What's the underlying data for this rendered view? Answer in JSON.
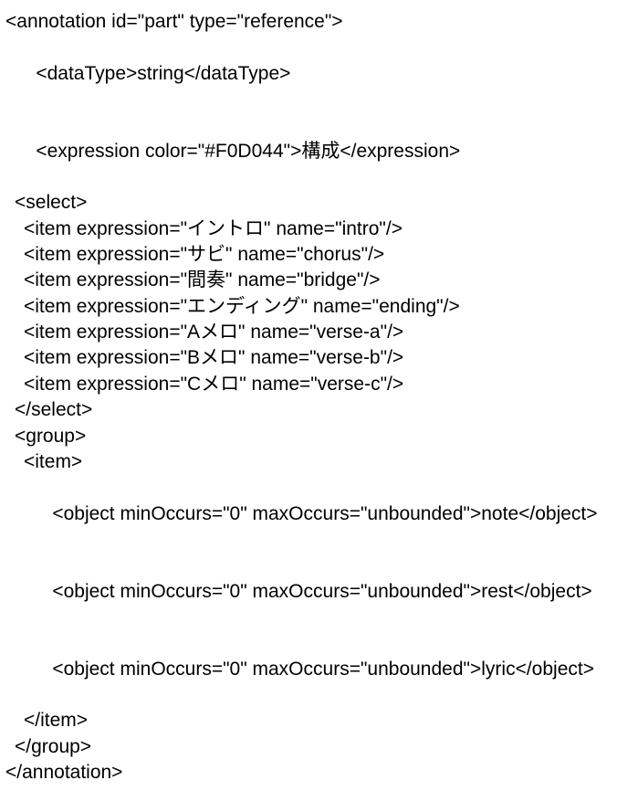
{
  "annotation": {
    "open": "<annotation id=\"part\" type=\"reference\">",
    "close": "</annotation>",
    "dataType": {
      "open": "<dataType>",
      "text": "string",
      "close": "</dataType>"
    },
    "expression": {
      "open": "<expression color=\"#F0D044\">",
      "text": "構成",
      "close": "</expression>"
    },
    "select": {
      "open": "<select>",
      "close": "</select>",
      "items": [
        "<item expression=\"イントロ\" name=\"intro\"/>",
        "<item expression=\"サビ\" name=\"chorus\"/>",
        "<item expression=\"間奏\" name=\"bridge\"/>",
        "<item expression=\"エンディング\" name=\"ending\"/>",
        "<item expression=\"Aメロ\" name=\"verse-a\"/>",
        "<item expression=\"Bメロ\" name=\"verse-b\"/>",
        "<item expression=\"Cメロ\" name=\"verse-c\"/>"
      ]
    },
    "group": {
      "open": "<group>",
      "close": "</group>",
      "item": {
        "open": "<item>",
        "close": "</item>",
        "objects": [
          {
            "open": "<object minOccurs=\"0\" maxOccurs=\"unbounded\">",
            "text": "note",
            "close": "</object>"
          },
          {
            "open": "<object minOccurs=\"0\" maxOccurs=\"unbounded\">",
            "text": "rest",
            "close": "</object>"
          },
          {
            "open": "<object minOccurs=\"0\" maxOccurs=\"unbounded\">",
            "text": "lyric",
            "close": "</object>"
          }
        ]
      }
    }
  }
}
